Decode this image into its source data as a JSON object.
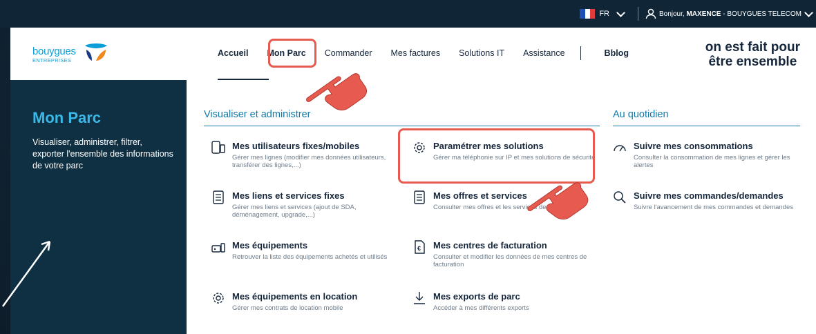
{
  "topbar": {
    "lang": "FR",
    "greeting_prefix": "Bonjour, ",
    "user": "MAXENCE",
    "company": " - BOUYGUES TELECOM"
  },
  "logo": {
    "word": "bouygues",
    "sub": "ENTREPRISES"
  },
  "nav": {
    "items": [
      "Accueil",
      "Mon Parc",
      "Commander",
      "Mes factures",
      "Solutions IT",
      "Assistance"
    ],
    "bblog": "Bblog"
  },
  "slogan": {
    "line1": "on est fait pour",
    "line2": "être ensemble"
  },
  "leftpanel": {
    "title": "Mon Parc",
    "desc": "Visualiser, administrer, filtrer, exporter l'ensemble des informations de votre parc"
  },
  "sections": {
    "admin_title": "Visualiser et administrer",
    "daily_title": "Au quotidien"
  },
  "entries": {
    "users": {
      "title": "Mes utilisateurs fixes/mobiles",
      "desc": "Gérer mes lignes (modifier mes données utilisateurs, transférer des lignes,...)",
      "icon": "phone-devices-icon"
    },
    "links": {
      "title": "Mes liens et services fixes",
      "desc": "Gérer mes liens et services (ajout de SDA, déménagement, upgrade,...)",
      "icon": "document-list-icon"
    },
    "equip": {
      "title": "Mes équipements",
      "desc": "Retrouver la liste des équipements achetés et utilisés",
      "icon": "equipment-icon"
    },
    "rent": {
      "title": "Mes équipements en location",
      "desc": "Gérer mes contrats de location mobile",
      "icon": "gear-icon"
    },
    "params": {
      "title": "Paramétrer mes solutions",
      "desc": "Gérer ma téléphonie sur IP et mes solutions de sécurité",
      "icon": "gear-icon"
    },
    "offers": {
      "title": "Mes offres et services",
      "desc": "Consulter mes offres et les services de mon parc",
      "icon": "document-list-icon"
    },
    "billing": {
      "title": "Mes centres de facturation",
      "desc": "Consulter et modifier les données de mes centres de facturation",
      "icon": "invoice-icon"
    },
    "exports": {
      "title": "Mes exports de parc",
      "desc": "Accéder à mes différents exports",
      "icon": "download-icon"
    },
    "consump": {
      "title": "Suivre mes consommations",
      "desc": "Consulter la consommation de mes lignes et gérer les alertes",
      "icon": "gauge-icon"
    },
    "orders": {
      "title": "Suivre mes commandes/demandes",
      "desc": "Suivre l'avancement de mes commandes et demandes",
      "icon": "search-icon"
    }
  },
  "colors": {
    "accent": "#0f7aa8",
    "highlight": "#e65a4f",
    "panel": "#0f3042",
    "title_blue": "#3ab9e7"
  }
}
